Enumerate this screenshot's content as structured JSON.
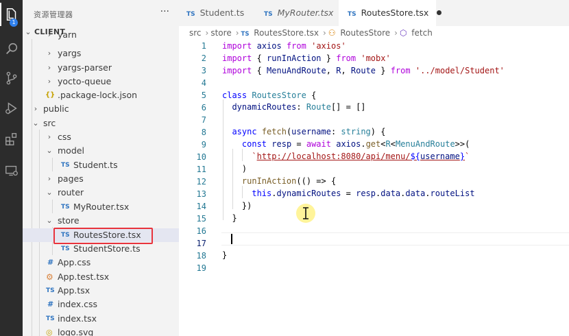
{
  "sidebar": {
    "title": "资源管理器",
    "more": "···",
    "root": "CLIENT",
    "items": [
      {
        "label": "yarn",
        "kind": "folder",
        "expanded": false
      },
      {
        "label": "yargs",
        "kind": "folder",
        "expanded": false
      },
      {
        "label": "yargs-parser",
        "kind": "folder",
        "expanded": false
      },
      {
        "label": "yocto-queue",
        "kind": "folder",
        "expanded": false
      },
      {
        "label": ".package-lock.json",
        "kind": "json",
        "icon": "{}"
      },
      {
        "label": "public",
        "kind": "folder",
        "expanded": false
      },
      {
        "label": "src",
        "kind": "folder",
        "expanded": true
      },
      {
        "label": "css",
        "kind": "folder",
        "expanded": false
      },
      {
        "label": "model",
        "kind": "folder",
        "expanded": true
      },
      {
        "label": "Student.ts",
        "kind": "ts",
        "icon": "TS"
      },
      {
        "label": "pages",
        "kind": "folder",
        "expanded": false
      },
      {
        "label": "router",
        "kind": "folder",
        "expanded": true
      },
      {
        "label": "MyRouter.tsx",
        "kind": "ts",
        "icon": "TS"
      },
      {
        "label": "store",
        "kind": "folder",
        "expanded": true
      },
      {
        "label": "RoutesStore.tsx",
        "kind": "ts",
        "icon": "TS",
        "selected": true
      },
      {
        "label": "StudentStore.ts",
        "kind": "ts",
        "icon": "TS"
      },
      {
        "label": "App.css",
        "kind": "css",
        "icon": "#"
      },
      {
        "label": "App.test.tsx",
        "kind": "test",
        "icon": "⚙"
      },
      {
        "label": "App.tsx",
        "kind": "ts",
        "icon": "TS"
      },
      {
        "label": "index.css",
        "kind": "css",
        "icon": "#"
      },
      {
        "label": "index.tsx",
        "kind": "ts",
        "icon": "TS"
      },
      {
        "label": "logo.svg",
        "kind": "svg",
        "icon": "◎"
      }
    ]
  },
  "activity": {
    "badge": "1",
    "icons": [
      "files-icon",
      "search-icon",
      "source-control-icon",
      "run-debug-icon",
      "extensions-icon",
      "remote-explorer-icon"
    ]
  },
  "tabs": [
    {
      "icon": "TS",
      "label": "Student.ts",
      "active": false,
      "italic": false
    },
    {
      "icon": "TS",
      "label": "MyRouter.tsx",
      "active": false,
      "italic": true
    },
    {
      "icon": "TS",
      "label": "RoutesStore.tsx",
      "active": true,
      "italic": false,
      "modified": true
    }
  ],
  "breadcrumb": {
    "src": "src",
    "store": "store",
    "file": "RoutesStore.tsx",
    "cls": "RoutesStore",
    "method": "fetch",
    "ts_icon": "TS"
  },
  "editor": {
    "line_numbers": [
      "1",
      "2",
      "3",
      "4",
      "5",
      "6",
      "7",
      "8",
      "9",
      "10",
      "11",
      "12",
      "13",
      "14",
      "15",
      "16",
      "17",
      "18",
      "19"
    ],
    "current_line": 17
  },
  "colors": {
    "activity_bg": "#2c2c2c",
    "sidebar_bg": "#f3f3f3",
    "highlight_box": "#e8333c",
    "keyword": "#0000ff",
    "control_keyword": "#af00db",
    "string": "#a31515",
    "type": "#267f99",
    "line_number": "#237893"
  }
}
